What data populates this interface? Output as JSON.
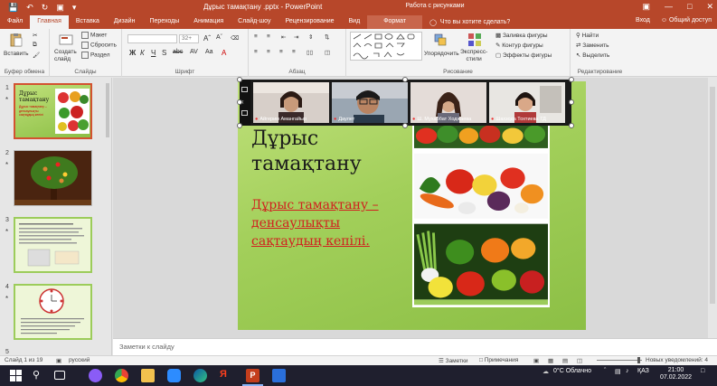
{
  "titlebar": {
    "document_title": "Дұрыс тамақтану .pptx - PowerPoint",
    "context_title": "Работа с рисунками",
    "save_icon": "save-icon",
    "undo_icon": "undo-icon",
    "redo_icon": "redo-icon",
    "start_icon": "present-icon"
  },
  "tabs": {
    "items": [
      "Файл",
      "Главная",
      "Вставка",
      "Дизайн",
      "Переходы",
      "Анимация",
      "Слайд-шоу",
      "Рецензирование",
      "Вид",
      "Формат"
    ],
    "tell_me": "Что вы хотите сделать?",
    "sign_in": "Вход",
    "share": "Общий доступ"
  },
  "ribbon": {
    "clipboard": {
      "paste": "Вставить",
      "label": "Буфер обмена"
    },
    "slides": {
      "new_slide_line1": "Создать",
      "new_slide_line2": "слайд",
      "layout": "Макет",
      "reset": "Сбросить",
      "section": "Раздел",
      "label": "Слайды"
    },
    "font": {
      "size": "32+",
      "label": "Шрифт"
    },
    "paragraph": {
      "label": "Абзац"
    },
    "drawing": {
      "arrange": "Упорядочить",
      "quick_styles_line1": "Экспресс-",
      "quick_styles_line2": "стили",
      "fill": "Заливка фигуры",
      "outline": "Контур фигуры",
      "effects": "Эффекты фигуры",
      "label": "Рисование"
    },
    "editing": {
      "find": "Найти",
      "replace": "Заменить",
      "select": "Выделить",
      "label": "Редактирование"
    }
  },
  "thumbnails": [
    {
      "number": "1",
      "title_line1": "Дұрыс",
      "title_line2": "тамақтану",
      "caption": "Дұрыс тамақтану – денсаулықты сақтаудың кепілі"
    },
    {
      "number": "2"
    },
    {
      "number": "3"
    },
    {
      "number": "4"
    },
    {
      "number": "5"
    }
  ],
  "slide": {
    "title": "Дұрыс тамақтану",
    "subtitle": "Дұрыс тамақтану – денсаулықты сақтаудың кепілі."
  },
  "video_participants": [
    {
      "name": "Айгерим Амангайыр"
    },
    {
      "name": "Даулет"
    },
    {
      "name": "Ш. Мухаббат Ходжаева"
    },
    {
      "name": "Шахзода Тохтиева 7Д"
    }
  ],
  "notes": {
    "placeholder": "Заметки к слайду"
  },
  "statusbar": {
    "slide_info": "Слайд 1 из 19",
    "language": "русский",
    "notes": "Заметки",
    "comments": "Примечания",
    "new_notifications": "Новых уведомлений: 4"
  },
  "taskbar": {
    "weather": "0°C Облачно",
    "language": "ҚАЗ",
    "time": "21:00",
    "date": "07.02.2022"
  },
  "colors": {
    "accent": "#b7472a",
    "slide_bg": "#a2cf5a",
    "subtitle": "#d11f1f"
  }
}
